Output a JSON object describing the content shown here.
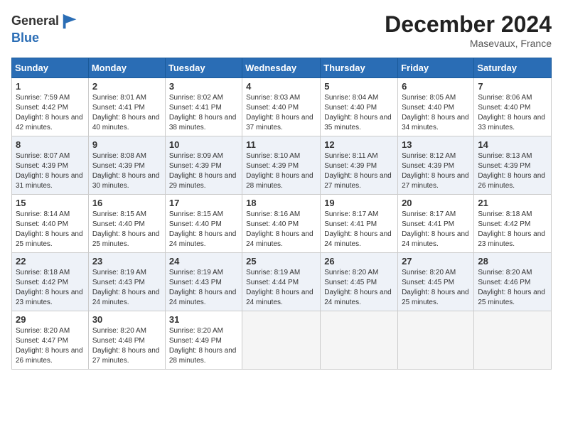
{
  "header": {
    "logo_line1": "General",
    "logo_line2": "Blue",
    "month": "December 2024",
    "location": "Masevaux, France"
  },
  "days_of_week": [
    "Sunday",
    "Monday",
    "Tuesday",
    "Wednesday",
    "Thursday",
    "Friday",
    "Saturday"
  ],
  "weeks": [
    [
      {
        "day": "1",
        "sunrise": "7:59 AM",
        "sunset": "4:42 PM",
        "daylight": "8 hours and 42 minutes."
      },
      {
        "day": "2",
        "sunrise": "8:01 AM",
        "sunset": "4:41 PM",
        "daylight": "8 hours and 40 minutes."
      },
      {
        "day": "3",
        "sunrise": "8:02 AM",
        "sunset": "4:41 PM",
        "daylight": "8 hours and 38 minutes."
      },
      {
        "day": "4",
        "sunrise": "8:03 AM",
        "sunset": "4:40 PM",
        "daylight": "8 hours and 37 minutes."
      },
      {
        "day": "5",
        "sunrise": "8:04 AM",
        "sunset": "4:40 PM",
        "daylight": "8 hours and 35 minutes."
      },
      {
        "day": "6",
        "sunrise": "8:05 AM",
        "sunset": "4:40 PM",
        "daylight": "8 hours and 34 minutes."
      },
      {
        "day": "7",
        "sunrise": "8:06 AM",
        "sunset": "4:40 PM",
        "daylight": "8 hours and 33 minutes."
      }
    ],
    [
      {
        "day": "8",
        "sunrise": "8:07 AM",
        "sunset": "4:39 PM",
        "daylight": "8 hours and 31 minutes."
      },
      {
        "day": "9",
        "sunrise": "8:08 AM",
        "sunset": "4:39 PM",
        "daylight": "8 hours and 30 minutes."
      },
      {
        "day": "10",
        "sunrise": "8:09 AM",
        "sunset": "4:39 PM",
        "daylight": "8 hours and 29 minutes."
      },
      {
        "day": "11",
        "sunrise": "8:10 AM",
        "sunset": "4:39 PM",
        "daylight": "8 hours and 28 minutes."
      },
      {
        "day": "12",
        "sunrise": "8:11 AM",
        "sunset": "4:39 PM",
        "daylight": "8 hours and 27 minutes."
      },
      {
        "day": "13",
        "sunrise": "8:12 AM",
        "sunset": "4:39 PM",
        "daylight": "8 hours and 27 minutes."
      },
      {
        "day": "14",
        "sunrise": "8:13 AM",
        "sunset": "4:39 PM",
        "daylight": "8 hours and 26 minutes."
      }
    ],
    [
      {
        "day": "15",
        "sunrise": "8:14 AM",
        "sunset": "4:40 PM",
        "daylight": "8 hours and 25 minutes."
      },
      {
        "day": "16",
        "sunrise": "8:15 AM",
        "sunset": "4:40 PM",
        "daylight": "8 hours and 25 minutes."
      },
      {
        "day": "17",
        "sunrise": "8:15 AM",
        "sunset": "4:40 PM",
        "daylight": "8 hours and 24 minutes."
      },
      {
        "day": "18",
        "sunrise": "8:16 AM",
        "sunset": "4:40 PM",
        "daylight": "8 hours and 24 minutes."
      },
      {
        "day": "19",
        "sunrise": "8:17 AM",
        "sunset": "4:41 PM",
        "daylight": "8 hours and 24 minutes."
      },
      {
        "day": "20",
        "sunrise": "8:17 AM",
        "sunset": "4:41 PM",
        "daylight": "8 hours and 24 minutes."
      },
      {
        "day": "21",
        "sunrise": "8:18 AM",
        "sunset": "4:42 PM",
        "daylight": "8 hours and 23 minutes."
      }
    ],
    [
      {
        "day": "22",
        "sunrise": "8:18 AM",
        "sunset": "4:42 PM",
        "daylight": "8 hours and 23 minutes."
      },
      {
        "day": "23",
        "sunrise": "8:19 AM",
        "sunset": "4:43 PM",
        "daylight": "8 hours and 24 minutes."
      },
      {
        "day": "24",
        "sunrise": "8:19 AM",
        "sunset": "4:43 PM",
        "daylight": "8 hours and 24 minutes."
      },
      {
        "day": "25",
        "sunrise": "8:19 AM",
        "sunset": "4:44 PM",
        "daylight": "8 hours and 24 minutes."
      },
      {
        "day": "26",
        "sunrise": "8:20 AM",
        "sunset": "4:45 PM",
        "daylight": "8 hours and 24 minutes."
      },
      {
        "day": "27",
        "sunrise": "8:20 AM",
        "sunset": "4:45 PM",
        "daylight": "8 hours and 25 minutes."
      },
      {
        "day": "28",
        "sunrise": "8:20 AM",
        "sunset": "4:46 PM",
        "daylight": "8 hours and 25 minutes."
      }
    ],
    [
      {
        "day": "29",
        "sunrise": "8:20 AM",
        "sunset": "4:47 PM",
        "daylight": "8 hours and 26 minutes."
      },
      {
        "day": "30",
        "sunrise": "8:20 AM",
        "sunset": "4:48 PM",
        "daylight": "8 hours and 27 minutes."
      },
      {
        "day": "31",
        "sunrise": "8:20 AM",
        "sunset": "4:49 PM",
        "daylight": "8 hours and 28 minutes."
      },
      null,
      null,
      null,
      null
    ]
  ]
}
